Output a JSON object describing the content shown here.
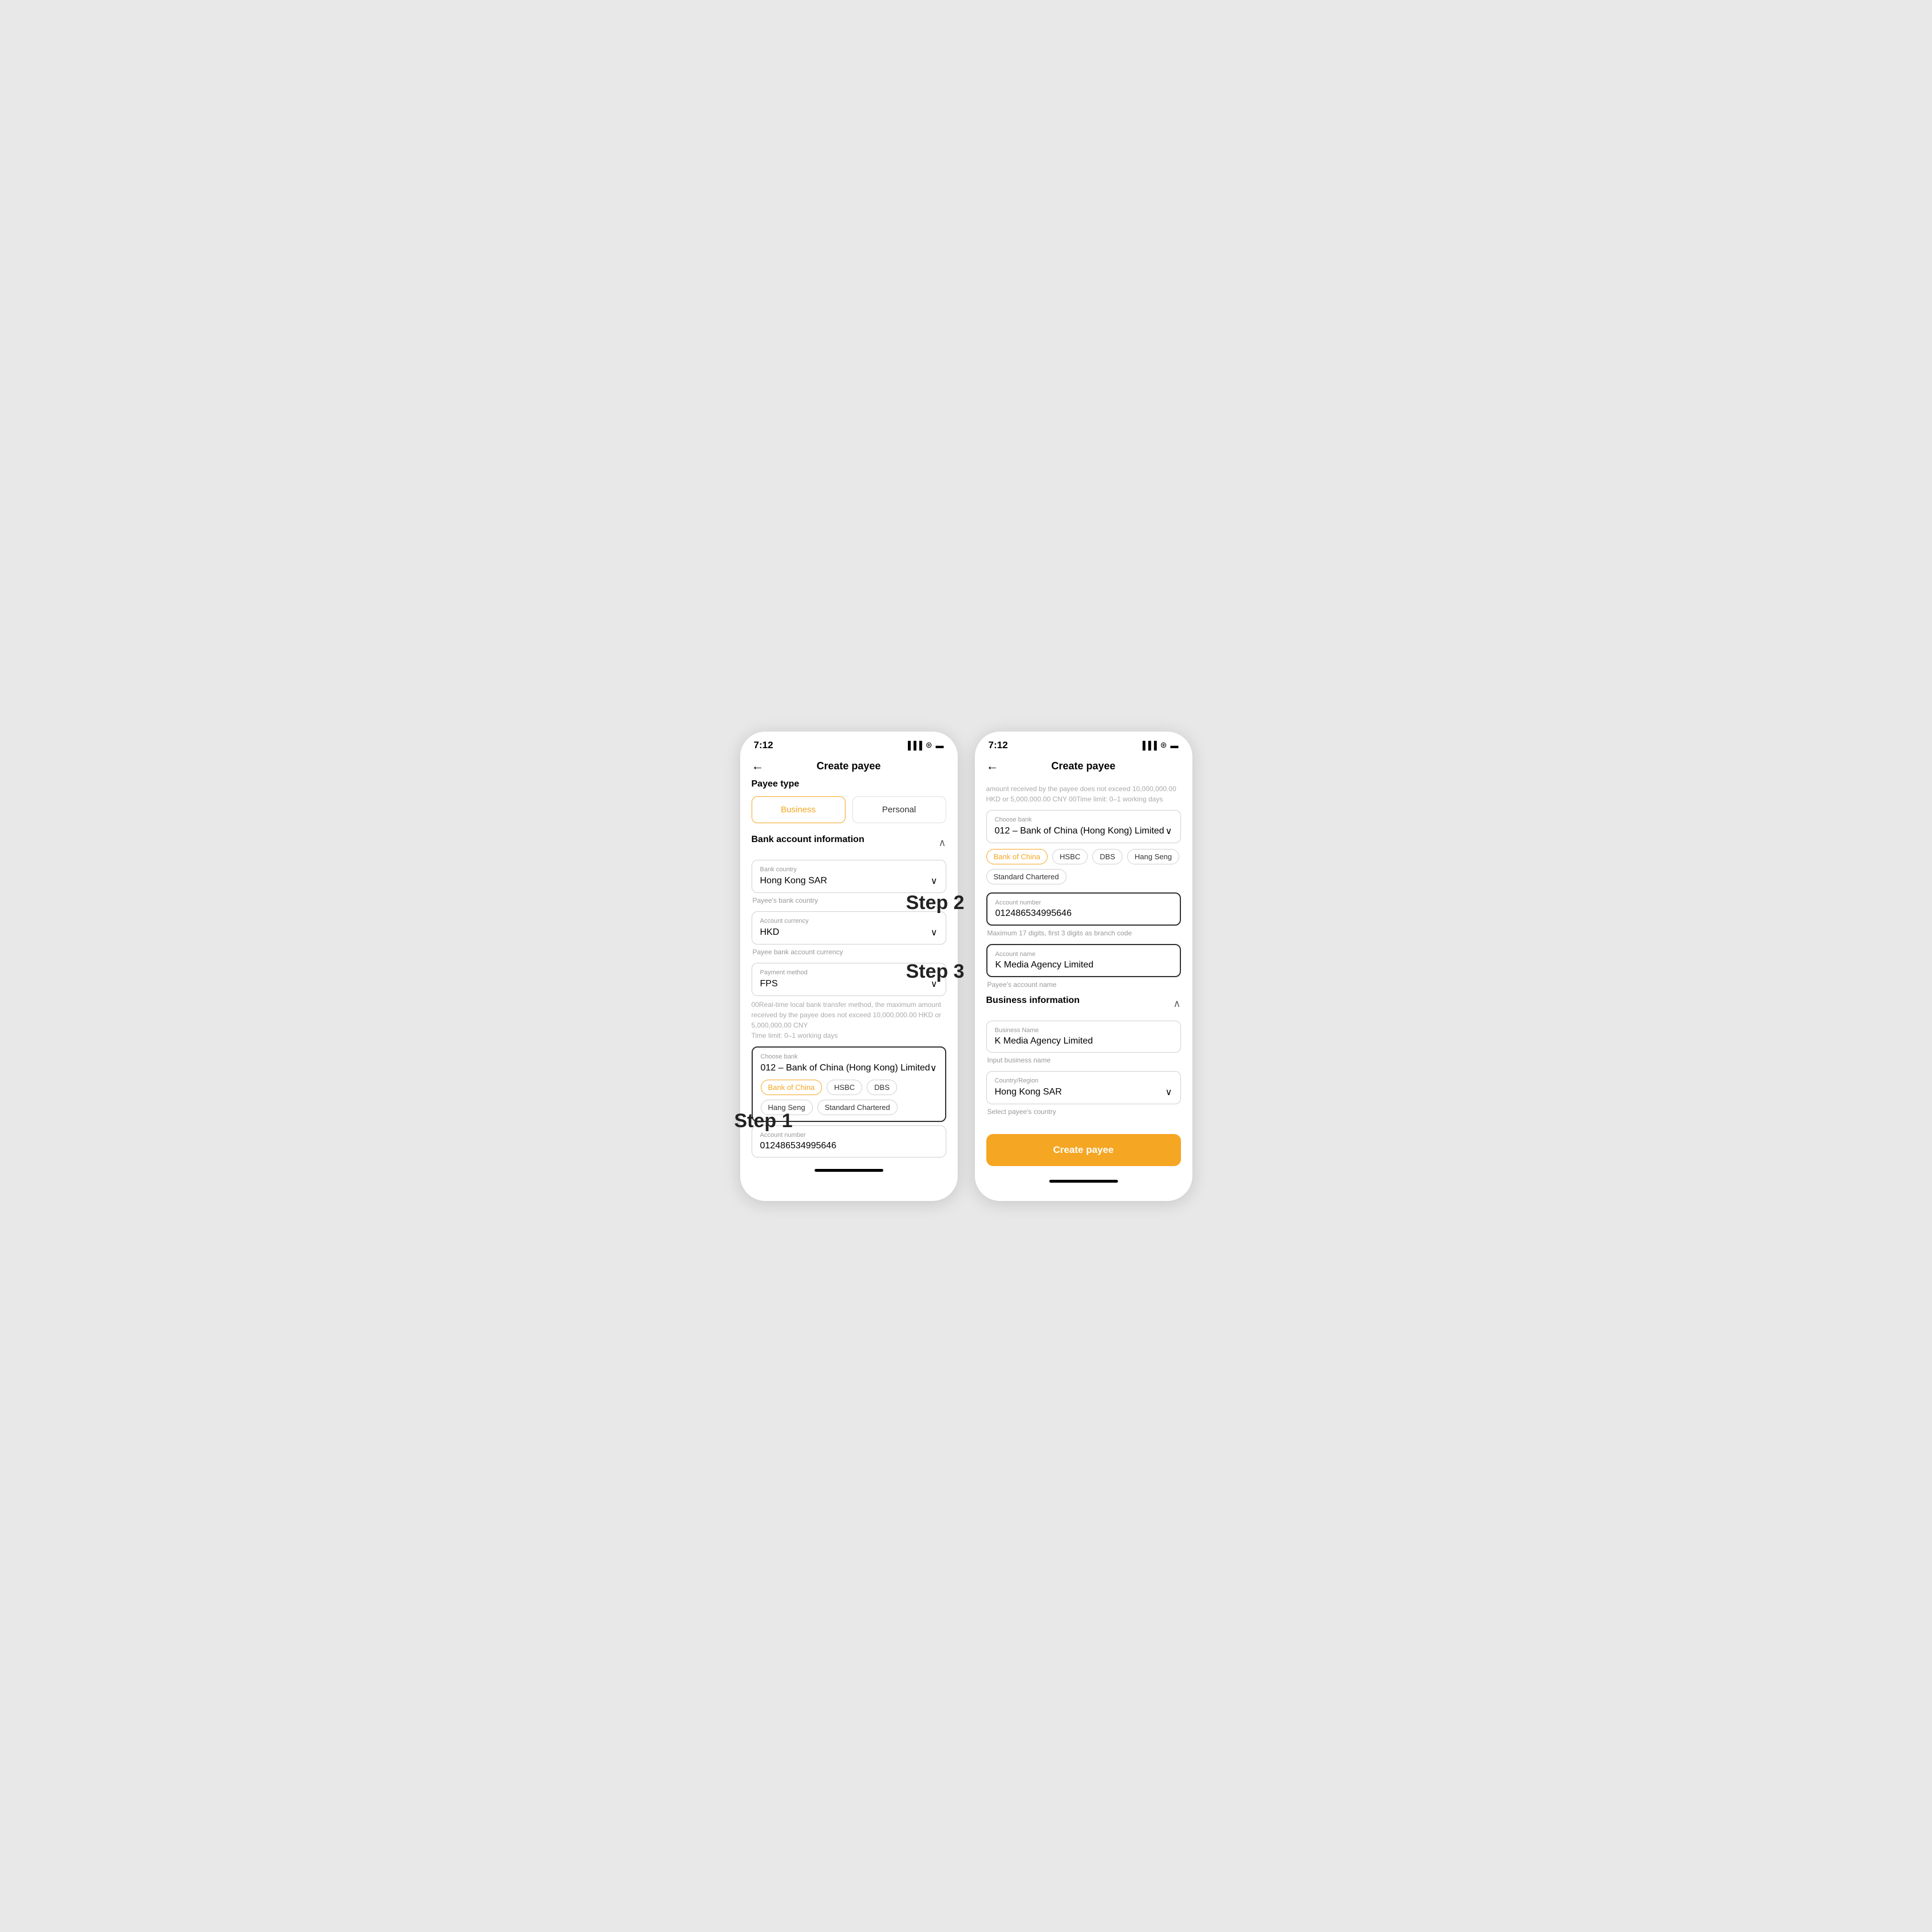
{
  "left_phone": {
    "status_time": "7:12",
    "nav_title": "Create payee",
    "nav_back": "←",
    "payee_type_section": "Payee type",
    "type_business": "Business",
    "type_personal": "Personal",
    "bank_info_section": "Bank account information",
    "bank_country_label": "Bank country",
    "bank_country_value": "Hong Kong SAR",
    "bank_country_hint": "Payee's bank country",
    "account_currency_label": "Account currency",
    "account_currency_value": "HKD",
    "account_currency_hint": "Payee bank account currency",
    "payment_method_label": "Payment method",
    "payment_method_value": "FPS",
    "payment_info": "00Real-time local bank transfer method, the maximum amount received by the payee does not exceed 10,000,000.00 HKD or 5,000,000.00 CNY\nTime limit: 0–1 working days",
    "choose_bank_label": "Choose bank",
    "choose_bank_value": "012 – Bank of China (Hong Kong) Limited",
    "chips": [
      "Bank of China",
      "HSBC",
      "DBS",
      "Hang Seng",
      "Standard Chartered"
    ],
    "chips_active": "Bank of China",
    "account_number_label": "Account number",
    "account_number_value": "012486534995646",
    "step1_label": "Step 1"
  },
  "right_phone": {
    "status_time": "7:12",
    "nav_title": "Create payee",
    "nav_back": "←",
    "truncated_info": "amount received by the payee does not exceed\n10,000,000.00 HKD or 5,000,000.00 CNY\n00Time limit: 0–1 working days",
    "choose_bank_label": "Choose bank",
    "choose_bank_value": "012 – Bank of China (Hong Kong) Limited",
    "chips": [
      "Bank of China",
      "HSBC",
      "DBS",
      "Hang Seng",
      "Standard Chartered"
    ],
    "chips_active": "Bank of China",
    "account_number_label": "Account number",
    "account_number_value": "012486534995646",
    "account_number_hint": "Maximum 17 digits, first 3 digits as branch code",
    "account_name_label": "Account name",
    "account_name_value": "K Media Agency Limited",
    "account_name_hint": "Payee's account name",
    "business_info_section": "Business information",
    "business_name_label": "Business Name",
    "business_name_value": "K Media Agency Limited",
    "business_name_hint": "Input business name",
    "country_region_label": "Country/Region",
    "country_region_value": "Hong Kong SAR",
    "country_region_hint": "Select payee's country",
    "create_btn": "Create payee",
    "step2_label": "Step 2",
    "step3_label": "Step 3"
  }
}
